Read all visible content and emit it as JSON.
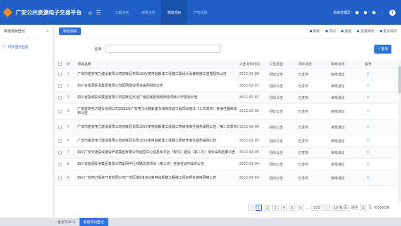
{
  "header": {
    "app_title": "广安公共资源电子交易平台",
    "tabs": [
      {
        "label": "工程业务"
      },
      {
        "label": "采购业务"
      },
      {
        "label": "新建项目",
        "active": true
      },
      {
        "label": "产权交易"
      }
    ],
    "user": "系统管理员",
    "help": "?"
  },
  "sidebar": {
    "title": "新建项目登记",
    "collapse": "«",
    "items": [
      {
        "label": "项目登记信息"
      }
    ]
  },
  "main": {
    "add_button": "新增项目",
    "toolbar": [
      {
        "label": "刷新"
      },
      {
        "label": "导出"
      },
      {
        "label": "删除"
      },
      {
        "label": "批量审核"
      },
      {
        "label": "更多操作"
      }
    ],
    "search_label": "名称:",
    "search_value": "",
    "search_placeholder": "",
    "query_button": "查询"
  },
  "table": {
    "headers": {
      "idx": "序",
      "name": "项目名称",
      "date": "公告发布时间",
      "type": "公告类型",
      "status": "项目状态",
      "audit": "审核状态",
      "action": "操作"
    },
    "rows": [
      {
        "idx": "1",
        "name": "广安市金安电力建设有限公司前锋区东阳10kV变电站新建工程施工图设计及编制施工监理招标公告",
        "date": "2021-02-08",
        "type": "招标公告",
        "status": "已发布",
        "audit": "审核通过",
        "tall": false
      },
      {
        "idx": "2",
        "name": "四川省能源投资集团有限公司配网建设项目采购招标公告",
        "date": "2021-02-07",
        "type": "招标公告",
        "status": "已发布",
        "audit": "审核通过",
        "tall": false
      },
      {
        "idx": "3",
        "name": "四川省能源投资集团有限公司前锋区天池广场区域配电网改造项目公开招标公告",
        "date": "2021-02-07",
        "type": "招标公告",
        "status": "已发布",
        "audit": "审核通过",
        "tall": false
      },
      {
        "idx": "4",
        "name": "广安金安电力建设有限公司2021年广安电力设施新建及维修改造工程项目施工（三次发布）竞争性磋商采购公告",
        "date": "2021-02-06",
        "type": "招标公告",
        "status": "已发布",
        "audit": "审核通过",
        "tall": true
      },
      {
        "idx": "5",
        "name": "广安市金安电力建设有限公司前锋区东阳10kV变电站新建工程施工项目竞争性谈判采购公告（第二次发布）",
        "date": "2021-02-06",
        "type": "招标公告",
        "status": "已发布",
        "audit": "审核通过",
        "tall": true
      },
      {
        "idx": "6",
        "name": "广安市金安电力建设有限公司前锋区东阳10kV变电站新建工程施工项目竞争性谈判采购公告",
        "date": "2021-02-05",
        "type": "招标公告",
        "status": "已发布",
        "audit": "审核通过",
        "tall": false
      },
      {
        "idx": "7",
        "name": "四川广安交通投资建设开发集团有限公司运营中心信息化平台（软件）建设（第二次）询价采购结果公告",
        "date": "2021-02-05",
        "type": "招标公告",
        "status": "已发布",
        "audit": "审核通过",
        "tall": false
      },
      {
        "idx": "8",
        "name": "四川省能源投资集团有限公司配网中压线路改造项目（第三次）竞争性谈判采购公告",
        "date": "2021-02-04",
        "type": "招标公告",
        "status": "已发布",
        "audit": "审核通过",
        "tall": false
      },
      {
        "idx": "9",
        "name": "四川广安电力投资开发有限公司广安区域内10kV变电站新建工程施工招标项目资格预审公告",
        "date": "2021-02-03",
        "type": "招标公告",
        "status": "已发布",
        "audit": "审核通过",
        "tall": true
      }
    ],
    "action_icon": "search-icon"
  },
  "pager": {
    "prev": "‹",
    "pages": [
      "1",
      "2",
      "3",
      "4",
      "5",
      "6"
    ],
    "ellipsis": "…",
    "last_page": "100",
    "next": "›",
    "page_size": "10 条/页",
    "goto_label": "跳至",
    "goto_value": "1",
    "goto_unit": "页",
    "total": "共1001条"
  },
  "bottom_tabs": [
    {
      "label": "首页TOP-D"
    },
    {
      "label": "新建项目登记",
      "active": true
    }
  ]
}
